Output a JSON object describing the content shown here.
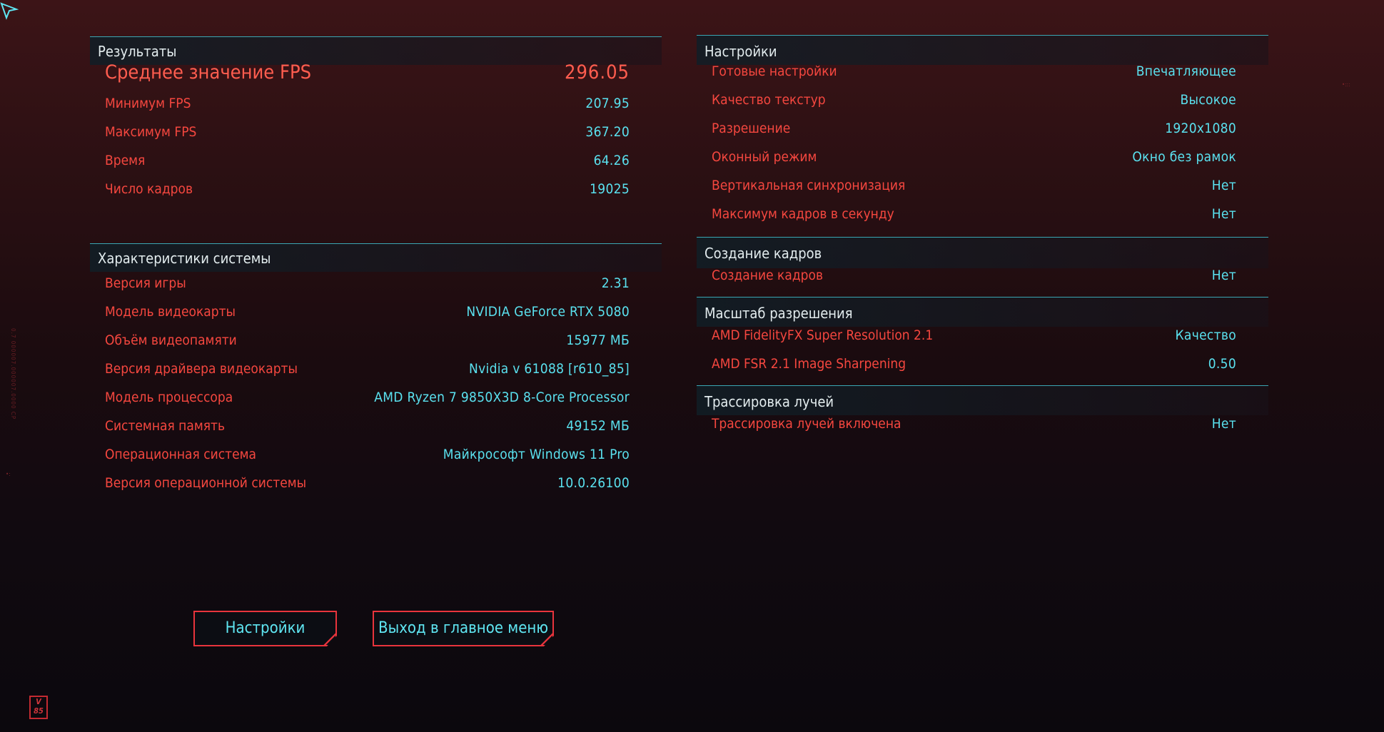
{
  "results": {
    "heading": "Результаты",
    "avg_fps": {
      "label": "Среднее значение FPS",
      "value": "296.05"
    },
    "rows": [
      {
        "label": "Минимум FPS",
        "value": "207.95"
      },
      {
        "label": "Максимум FPS",
        "value": "367.20"
      },
      {
        "label": "Время",
        "value": "64.26"
      },
      {
        "label": "Число кадров",
        "value": "19025"
      }
    ]
  },
  "system": {
    "heading": "Характеристики системы",
    "rows": [
      {
        "label": "Версия игры",
        "value": "2.31"
      },
      {
        "label": "Модель видеокарты",
        "value": "NVIDIA GeForce RTX 5080"
      },
      {
        "label": "Объём видеопамяти",
        "value": "15977 МБ"
      },
      {
        "label": "Версия драйвера видеокарты",
        "value": "Nvidia v 61088 [r610_85]"
      },
      {
        "label": "Модель процессора",
        "value": "AMD Ryzen 7 9850X3D 8-Core Processor"
      },
      {
        "label": "Системная память",
        "value": "49152 МБ"
      },
      {
        "label": "Операционная система",
        "value": "Майкрософт Windows 11 Pro"
      },
      {
        "label": "Версия операционной системы",
        "value": "10.0.26100"
      }
    ]
  },
  "settings": {
    "heading": "Настройки",
    "rows": [
      {
        "label": "Готовые настройки",
        "value": "Впечатляющее"
      },
      {
        "label": "Качество текстур",
        "value": "Высокое"
      },
      {
        "label": "Разрешение",
        "value": "1920x1080"
      },
      {
        "label": "Оконный режим",
        "value": "Окно без рамок"
      },
      {
        "label": "Вертикальная синхронизация",
        "value": "Нет"
      },
      {
        "label": "Максимум кадров в секунду",
        "value": "Нет"
      }
    ]
  },
  "frame_gen": {
    "heading": "Создание кадров",
    "rows": [
      {
        "label": "Создание кадров",
        "value": "Нет"
      }
    ]
  },
  "scaling": {
    "heading": "Масштаб разрешения",
    "rows": [
      {
        "label": "AMD FidelityFX Super Resolution 2.1",
        "value": "Качество"
      },
      {
        "label": "AMD FSR 2.1 Image Sharpening",
        "value": "0.50"
      }
    ]
  },
  "ray_tracing": {
    "heading": "Трассировка лучей",
    "rows": [
      {
        "label": "Трассировка лучей включена",
        "value": "Нет"
      }
    ]
  },
  "buttons": {
    "settings": "Настройки",
    "exit": "Выход в главное меню"
  },
  "logo": {
    "text": "V 85"
  },
  "colors": {
    "label": "#f5473f",
    "value": "#5ae1ef",
    "accent_border": "#e8343c",
    "section_line": "#3aa6b3"
  },
  "icons": {
    "cursor": "cursor-arrow-icon"
  }
}
